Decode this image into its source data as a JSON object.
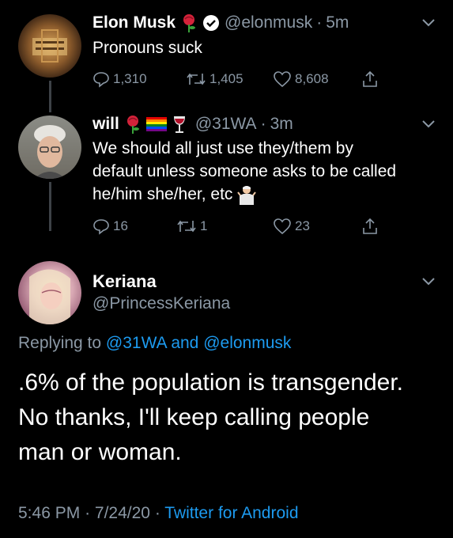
{
  "tweets": [
    {
      "name": "Elon Musk",
      "handle": "@elonmusk",
      "time": "5m",
      "name_emojis": [
        "rose-emoji"
      ],
      "verified": true,
      "text": "Pronouns suck",
      "replies": "1,310",
      "retweets": "1,405",
      "likes": "8,608"
    },
    {
      "name": "will",
      "handle": "@31WA",
      "time": "3m",
      "name_emojis": [
        "rose-emoji",
        "rainbow-flag-emoji",
        "wine-glass-emoji"
      ],
      "text_lines": [
        "We should all just use they/them by",
        "default unless someone asks to be called",
        "he/him she/her, etc"
      ],
      "replies": "16",
      "retweets": "1",
      "likes": "23"
    }
  ],
  "main_tweet": {
    "name": "Keriana",
    "handle": "@PrincessKeriana",
    "replying_prefix": "Replying to",
    "replying_to_1": "@31WA",
    "replying_and": "and",
    "replying_to_2": "@elonmusk",
    "text_lines": [
      ".6% of the population is transgender.",
      "No thanks, I'll keep calling people",
      "man or woman."
    ],
    "time": "5:46 PM",
    "date": "7/24/20",
    "source": "Twitter for Android"
  },
  "colors": {
    "background": "#000000",
    "secondary_text": "#8b98a5",
    "link": "#1d9bf0",
    "thread_line": "#3d4247"
  }
}
